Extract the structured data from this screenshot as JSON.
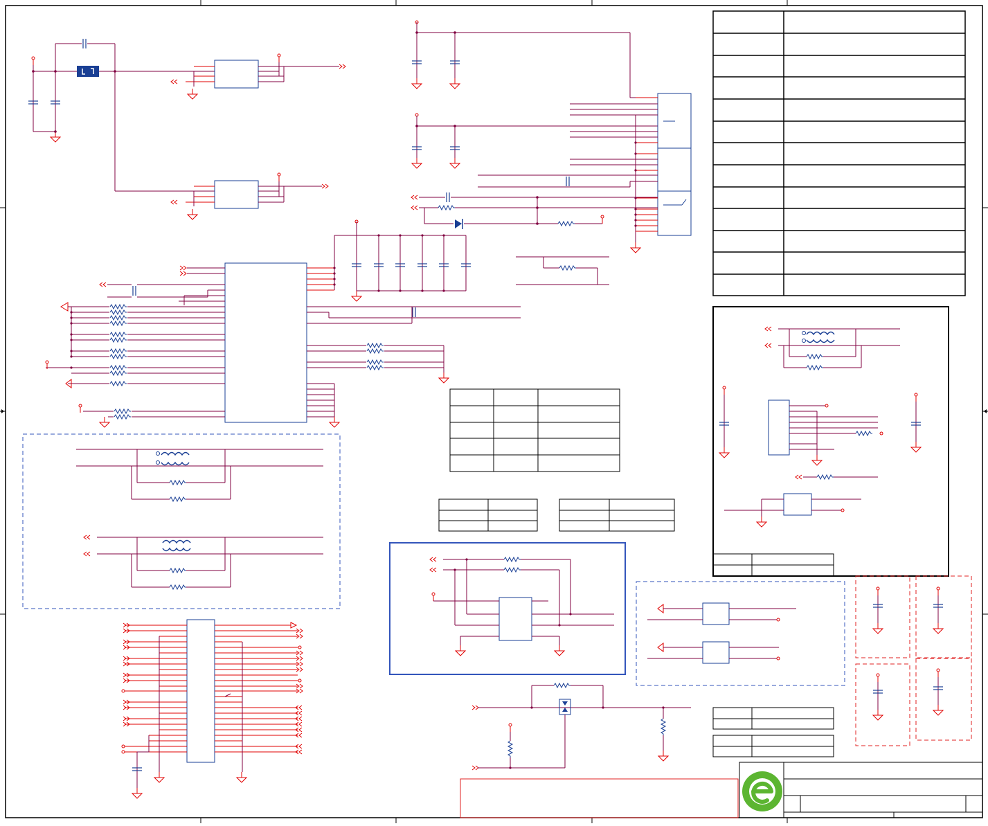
{
  "sheet": {
    "title": "",
    "logo": "green-e-logo"
  },
  "colors": {
    "wire": "#800040",
    "pin": "#e00000",
    "component": "#1a3f94",
    "border": "#000000",
    "dashed_blue": "#3355bb",
    "dashed_red": "#e02020",
    "logo_green": "#5cb531"
  },
  "icons": [
    "ground-symbol-icon",
    "power-arrow-icon",
    "crystal-icon",
    "transformer-icon",
    "resistor-icon",
    "capacitor-icon",
    "diode-icon",
    "connector-icon"
  ]
}
